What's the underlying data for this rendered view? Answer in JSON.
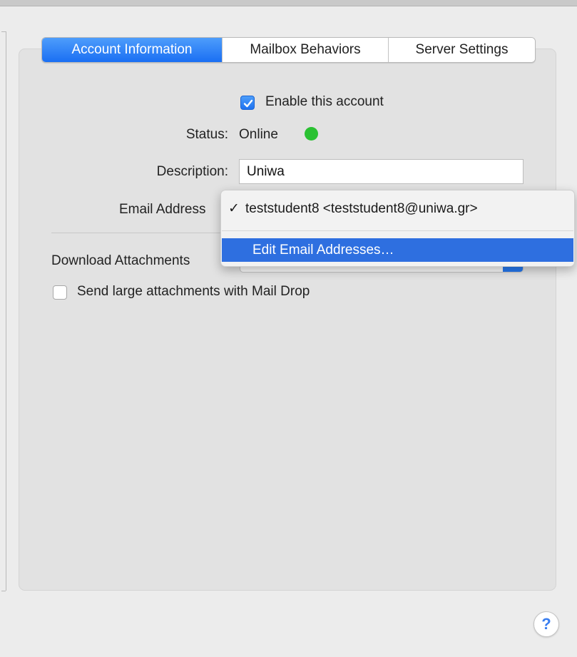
{
  "tabs": [
    {
      "label": "Account Information",
      "active": true
    },
    {
      "label": "Mailbox Behaviors",
      "active": false
    },
    {
      "label": "Server Settings",
      "active": false
    }
  ],
  "form": {
    "enable_account": {
      "label": "Enable this account",
      "checked": true
    },
    "status": {
      "label": "Status:",
      "value": "Online",
      "indicator_color": "#2ac132"
    },
    "description": {
      "label": "Description:",
      "value": "Uniwa"
    },
    "email_address": {
      "label": "Email Address"
    },
    "download_attachments": {
      "label": "Download Attachments"
    },
    "mail_drop": {
      "label": "Send large attachments with Mail Drop",
      "checked": false
    }
  },
  "email_popup": {
    "items": [
      {
        "label": "teststudent8 <teststudent8@uniwa.gr>",
        "checked": true,
        "check_glyph": "✓"
      },
      {
        "label": "Edit Email Addresses…",
        "highlighted": true
      }
    ]
  },
  "help": {
    "label": "?"
  },
  "colors": {
    "accent": "#1a6ff3",
    "menu_highlight": "#2e6fe0",
    "online": "#2ac132"
  }
}
